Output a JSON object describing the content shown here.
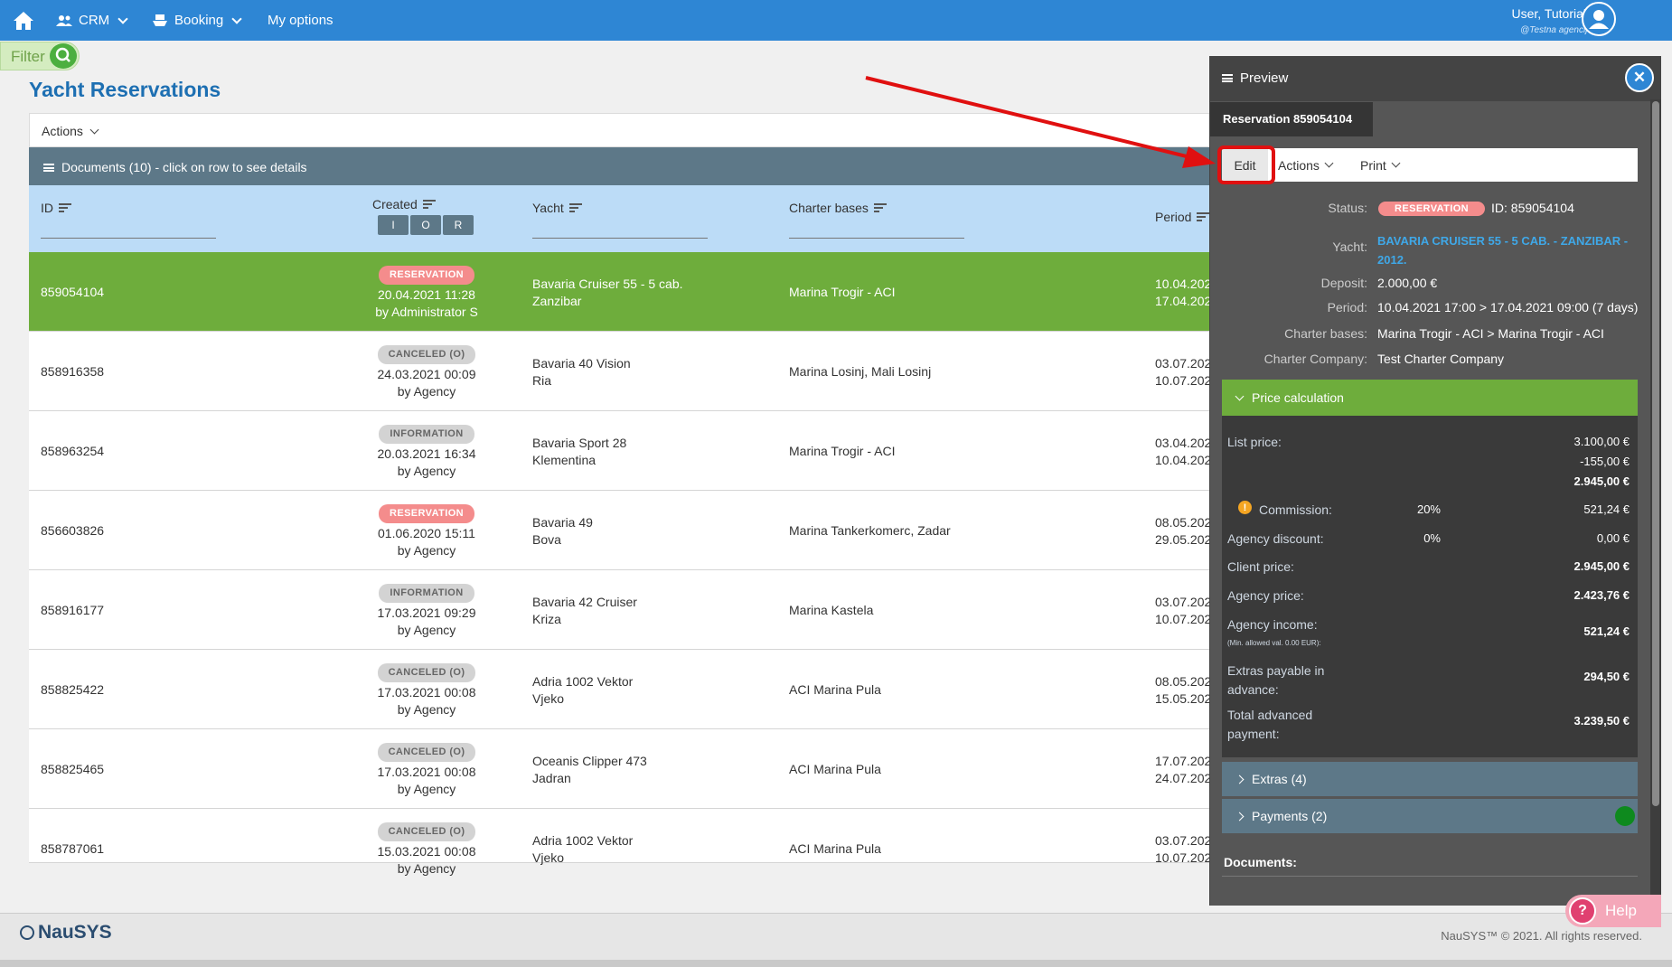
{
  "nav": {
    "home_icon": "home-icon",
    "crm_label": "CRM",
    "booking_label": "Booking",
    "my_options_label": "My options",
    "user_name": "User, Tutorials",
    "user_agency": "@Testna agencija"
  },
  "filter": {
    "label": "Filter"
  },
  "page": {
    "title": "Yacht Reservations",
    "actions_label": "Actions",
    "documents_label": "Documents (10) - click on row to see details"
  },
  "table": {
    "columns": {
      "id": "ID",
      "created": "Created",
      "yacht": "Yacht",
      "bases": "Charter bases",
      "period": "Period"
    },
    "ior": [
      "I",
      "O",
      "R"
    ],
    "rows": [
      {
        "id": "859054104",
        "badge": "RESERVATION",
        "date": "20.04.2021 11:28",
        "by": "by Administrator S",
        "yacht1": "Bavaria Cruiser 55 - 5 cab.",
        "yacht2": "Zanzibar",
        "base": "Marina Trogir - ACI",
        "p1": "10.04.202",
        "p2": "17.04.202"
      },
      {
        "id": "858916358",
        "badge": "CANCELED (O)",
        "date": "24.03.2021 00:09",
        "by": "by Agency",
        "yacht1": "Bavaria 40 Vision",
        "yacht2": "Ria",
        "base": "Marina Losinj, Mali Losinj",
        "p1": "03.07.202",
        "p2": "10.07.202"
      },
      {
        "id": "858963254",
        "badge": "INFORMATION",
        "date": "20.03.2021 16:34",
        "by": "by Agency",
        "yacht1": "Bavaria Sport 28",
        "yacht2": "Klementina",
        "base": "Marina Trogir - ACI",
        "p1": "03.04.202",
        "p2": "10.04.202"
      },
      {
        "id": "856603826",
        "badge": "RESERVATION",
        "date": "01.06.2020 15:11",
        "by": "by Agency",
        "yacht1": "Bavaria 49",
        "yacht2": "Bova",
        "base": "Marina Tankerkomerc, Zadar",
        "p1": "08.05.202",
        "p2": "29.05.202"
      },
      {
        "id": "858916177",
        "badge": "INFORMATION",
        "date": "17.03.2021 09:29",
        "by": "by Agency",
        "yacht1": "Bavaria 42 Cruiser",
        "yacht2": "Kriza",
        "base": "Marina Kastela",
        "p1": "03.07.202",
        "p2": "10.07.202"
      },
      {
        "id": "858825422",
        "badge": "CANCELED (O)",
        "date": "17.03.2021 00:08",
        "by": "by Agency",
        "yacht1": "Adria 1002 Vektor",
        "yacht2": "Vjeko",
        "base": "ACI Marina Pula",
        "p1": "08.05.202",
        "p2": "15.05.202"
      },
      {
        "id": "858825465",
        "badge": "CANCELED (O)",
        "date": "17.03.2021 00:08",
        "by": "by Agency",
        "yacht1": "Oceanis Clipper 473",
        "yacht2": "Jadran",
        "base": "ACI Marina Pula",
        "p1": "17.07.202",
        "p2": "24.07.202"
      },
      {
        "id": "858787061",
        "badge": "CANCELED (O)",
        "date": "15.03.2021 00:08",
        "by": "by Agency",
        "yacht1": "Adria 1002 Vektor",
        "yacht2": "Vjeko",
        "base": "ACI Marina Pula",
        "p1": "03.07.202",
        "p2": "10.07.202"
      }
    ]
  },
  "preview": {
    "title": "Preview",
    "tab": "Reservation 859054104",
    "edit": "Edit",
    "actions": "Actions",
    "print": "Print",
    "status_label": "Status:",
    "status_value": "RESERVATION",
    "id_text": "ID: 859054104",
    "yacht_label": "Yacht:",
    "yacht_value_1": "BAVARIA CRUISER 55 - 5 CAB. - ZANZIBAR -",
    "yacht_value_2": "2012.",
    "deposit_label": "Deposit:",
    "deposit_value": "2.000,00 €",
    "period_label": "Period:",
    "period_value": "10.04.2021 17:00 > 17.04.2021 09:00 (7 days)",
    "bases_label": "Charter bases:",
    "bases_value": "Marina Trogir - ACI > Marina Trogir - ACI",
    "company_label": "Charter Company:",
    "company_value": "Test Charter Company",
    "price_calc_label": "Price calculation",
    "list_price_label": "List price:",
    "list_price_1": "3.100,00 €",
    "list_price_2": "-155,00 €",
    "list_price_3": "2.945,00 €",
    "commission_label": "Commission:",
    "commission_pct": "20%",
    "commission_value": "521,24 €",
    "agency_discount_label": "Agency discount:",
    "agency_discount_pct": "0%",
    "agency_discount_value": "0,00 €",
    "client_price_label": "Client price:",
    "client_price_value": "2.945,00 €",
    "agency_price_label": "Agency price:",
    "agency_price_value": "2.423,76 €",
    "agency_income_label": "Agency income:",
    "agency_income_note": "(Min. allowed val. 0.00 EUR):",
    "agency_income_value": "521,24 €",
    "extras_adv_label_1": "Extras payable in",
    "extras_adv_label_2": "advance:",
    "extras_adv_value": "294,50 €",
    "total_adv_label_1": "Total advanced",
    "total_adv_label_2": "payment:",
    "total_adv_value": "3.239,50 €",
    "extras_section": "Extras (4)",
    "payments_section": "Payments (2)",
    "documents_label": "Documents:"
  },
  "footer": {
    "logo": "NauSYS",
    "copyright": "NauSYS™ © 2021. All rights reserved."
  },
  "help": {
    "label": "Help"
  }
}
